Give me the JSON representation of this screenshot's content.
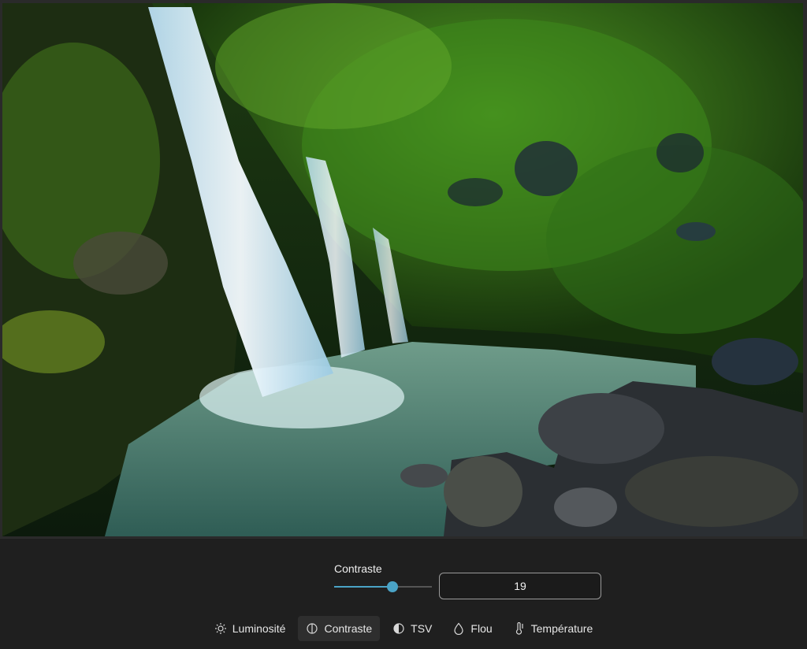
{
  "photo": {
    "subject": "waterfall-landscape"
  },
  "adjustment": {
    "label": "Contraste",
    "value": "19",
    "slider_fraction": 0.6
  },
  "tabs": [
    {
      "label": "Luminosité",
      "icon": "sun-icon"
    },
    {
      "label": "Contraste",
      "icon": "contrast-icon",
      "active": true
    },
    {
      "label": "TSV",
      "icon": "hsv-icon"
    },
    {
      "label": "Flou",
      "icon": "droplet-icon"
    },
    {
      "label": "Température",
      "icon": "thermometer-icon"
    }
  ],
  "colors": {
    "accent": "#4aa3c6",
    "panel": "#1f1f1f"
  }
}
